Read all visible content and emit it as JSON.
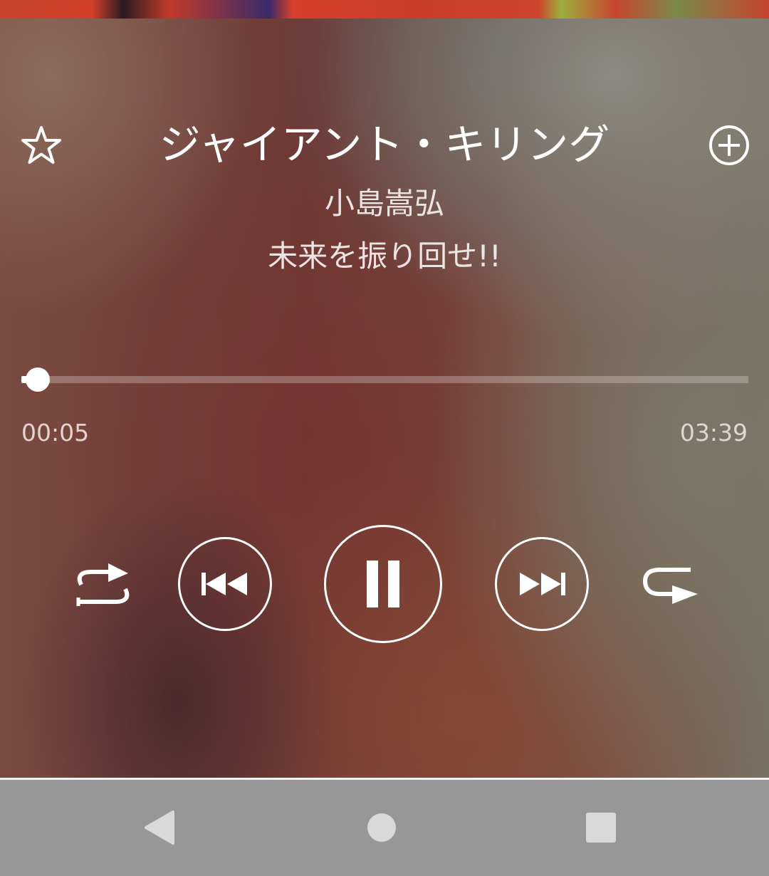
{
  "track": {
    "title": "ジャイアント・キリング",
    "artist": "小島嵩弘",
    "album": "未来を振り回せ!!"
  },
  "playback": {
    "elapsed": "00:05",
    "total": "03:39",
    "progress_fraction": 0.023,
    "state": "playing"
  },
  "icons": {
    "favorite": "star-outline-icon",
    "add": "plus-circle-icon",
    "shuffle": "shuffle-icon",
    "previous": "skip-previous-icon",
    "pause": "pause-icon",
    "next": "skip-next-icon",
    "repeat": "repeat-icon",
    "nav_back": "back-triangle-icon",
    "nav_home": "home-circle-icon",
    "nav_recent": "recent-square-icon"
  },
  "colors": {
    "foreground": "#ffffff",
    "navbar": "#979797",
    "nav_icon": "#d9d9d9"
  }
}
